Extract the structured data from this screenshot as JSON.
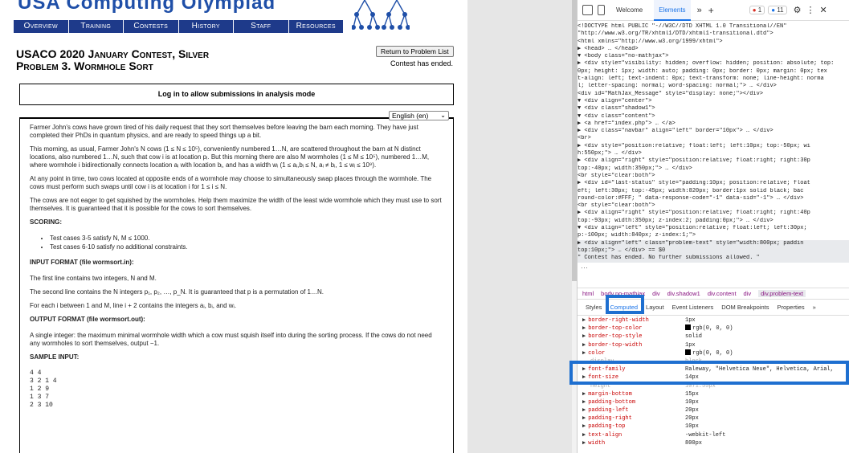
{
  "site": {
    "title": "USA Computing Olympiad",
    "nav": [
      "Overview",
      "Training",
      "Contests",
      "History",
      "Staff",
      "Resources"
    ]
  },
  "problem": {
    "title_line1": "USACO 2020 January Contest, Silver",
    "title_line2": "Problem 3. Wormhole Sort",
    "return_button": "Return to Problem List",
    "status": "Contest has ended.",
    "login_message": "Log in to allow submissions in analysis mode",
    "language": "English (en)",
    "paragraphs": [
      "Farmer John's cows have grown tired of his daily request that they sort themselves before leaving the barn each morning. They have just completed their PhDs in quantum physics, and are ready to speed things up a bit.",
      "This morning, as usual, Farmer John's N cows (1 ≤ N ≤ 10⁵), conveniently numbered 1…N, are scattered throughout the barn at N distinct locations, also numbered 1…N, such that cow i is at location pᵢ. But this morning there are also M wormholes (1 ≤ M ≤ 10⁵), numbered 1…M, where wormhole i bidirectionally connects location aᵢ with location bᵢ, and has a width wᵢ (1 ≤ aᵢ,bᵢ ≤ N, aᵢ ≠ bᵢ, 1 ≤ wᵢ ≤ 10⁹).",
      "At any point in time, two cows located at opposite ends of a wormhole may choose to simultaneously swap places through the wormhole. The cows must perform such swaps until cow i is at location i for 1 ≤ i ≤ N.",
      "The cows are not eager to get squished by the wormholes. Help them maximize the width of the least wide wormhole which they must use to sort themselves. It is guaranteed that it is possible for the cows to sort themselves."
    ],
    "scoring_header": "SCORING:",
    "scoring": [
      "Test cases 3-5 satisfy N, M ≤ 1000.",
      "Test cases 6-10 satisfy no additional constraints."
    ],
    "input_header": "INPUT FORMAT (file wormsort.in):",
    "input_paragraphs": [
      "The first line contains two integers, N and M.",
      "The second line contains the N integers p₁, p₂, …, p_N. It is guaranteed that p is a permutation of 1…N.",
      "For each i between 1 and M, line i + 2 contains the integers aᵢ, bᵢ, and wᵢ."
    ],
    "output_header": "OUTPUT FORMAT (file wormsort.out):",
    "output_paragraph": "A single integer: the maximum minimal wormhole width which a cow must squish itself into during the sorting process. If the cows do not need any wormholes to sort themselves, output −1.",
    "sample_header": "SAMPLE INPUT:",
    "sample_input": "4 4\n3 2 1 4\n1 2 9\n1 3 7\n2 3 10"
  },
  "devtools": {
    "tabs": [
      "Welcome",
      "Elements"
    ],
    "active_tab": "Elements",
    "error_count": "1",
    "info_count": "11",
    "dom_lines": [
      "<!DOCTYPE html PUBLIC \"-//W3C//DTD XHTML 1.0 Transitional//EN\"",
      "\"http://www.w3.org/TR/xhtml1/DTD/xhtml1-transitional.dtd\">",
      "<html xmlns=\"http://www.w3.org/1999/xhtml\">",
      "▶ <head> … </head>",
      "▼ <body class=\"no-mathjax\">",
      "  ▶ <div style=\"visibility: hidden; overflow: hidden; position: absolute; top:",
      "    0px; height: 1px; width: auto; padding: 0px; border: 0px; margin: 0px; tex",
      "    t-align: left; text-indent: 0px; text-transform: none; line-height: norma",
      "    l; letter-spacing: normal; word-spacing: normal;\"> … </div>",
      "    <div id=\"MathJax_Message\" style=\"display: none;\"></div>",
      "  ▼ <div align=\"center\">",
      "    ▼ <div class=\"shadow1\">",
      "      ▼ <div class=\"content\">",
      "        ▶ <a href=\"index.php\"> … </a>",
      "        ▶ <div class=\"navbar\" align=\"left\" border=\"10px\"> … </div>",
      "          <br>",
      "        ▶ <div style=\"position:relative; float:left; left:10px; top:-50px; wi",
      "          h:550px;\"> … </div>",
      "        ▶ <div align=\"right\" style=\"position:relative; float:right; right:30p",
      "          top:-40px; width:350px;\"> … </div>",
      "          <br style=\"clear:both\">",
      "        ▶ <div id=\"last-status\" style=\"padding:10px; position:relative; float",
      "          eft; left:30px; top:-45px; width:820px; border:1px solid black; bac",
      "          round-color:#FFF; \" data-response-code=\"-1\" data-sid=\"-1\"> … </div>",
      "          <br style=\"clear:both\">",
      "        ▶ <div align=\"right\" style=\"position:relative; float:right; right:40p",
      "          top:-93px; width:350px; z-index:2; padding:0px;\"> … </div>",
      "        ▼ <div align=\"left\" style=\"position:relative; float:left; left:30px;",
      "          p:-100px; width:840px; z-index:1;\">",
      "          ▶ <div align=\"left\" class=\"problem-text\" style=\"width:800px; paddin",
      "            top:10px;\"> … </div> == $0",
      "            \" Contest has ended. No further submissions allowed. \""
    ],
    "breadcrumbs": [
      "html",
      "body.no-mathjax",
      "div",
      "div.shadow1",
      "div.content",
      "div",
      "div.problem-text"
    ],
    "subtabs": [
      "Styles",
      "Computed",
      "Layout",
      "Event Listeners",
      "DOM Breakpoints",
      "Properties"
    ],
    "active_subtab": "Computed",
    "properties": [
      {
        "name": "border-right-width",
        "value": "1px"
      },
      {
        "name": "border-top-color",
        "value": "rgb(0, 0, 0)",
        "swatch": true
      },
      {
        "name": "border-top-style",
        "value": "solid"
      },
      {
        "name": "border-top-width",
        "value": "1px"
      },
      {
        "name": "color",
        "value": "rgb(0, 0, 0)",
        "swatch": true
      },
      {
        "name": "display",
        "value": "block",
        "faded": true
      },
      {
        "name": "font-family",
        "value": "Raleway, \"Helvetica Neue\", Helvetica, Arial,"
      },
      {
        "name": "font-size",
        "value": "14px"
      },
      {
        "name": "height",
        "value": "1071.55px",
        "faded": true
      },
      {
        "name": "margin-bottom",
        "value": "15px"
      },
      {
        "name": "padding-bottom",
        "value": "10px"
      },
      {
        "name": "padding-left",
        "value": "20px"
      },
      {
        "name": "padding-right",
        "value": "20px"
      },
      {
        "name": "padding-top",
        "value": "10px"
      },
      {
        "name": "text-align",
        "value": "-webkit-left"
      },
      {
        "name": "width",
        "value": "800px"
      }
    ]
  },
  "colors": {
    "accent": "#1e6fd0",
    "nav_bg": "#1e3a8a"
  }
}
